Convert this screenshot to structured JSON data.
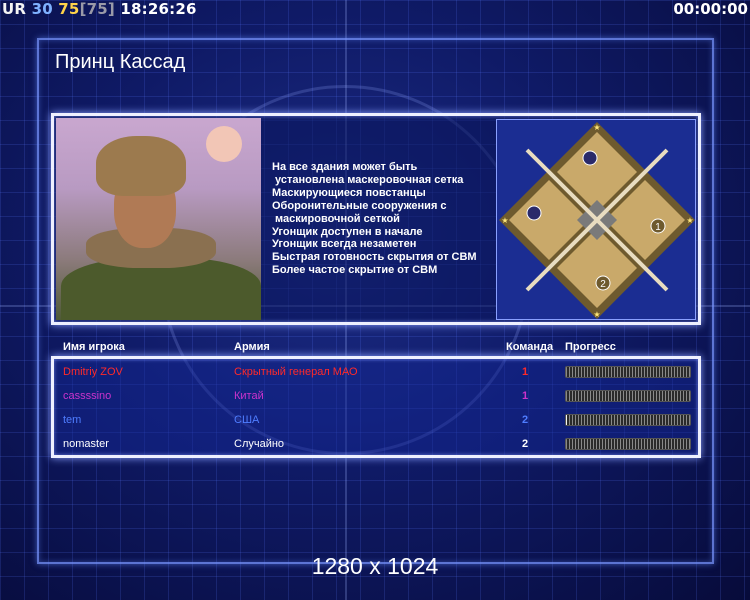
{
  "hud": {
    "ur_label": "UR",
    "ur_value": "30",
    "fps": "75",
    "fps_limit": "[75]",
    "clock": "18:26:26",
    "game_timer": "00:00:00"
  },
  "title": "Принц Кассад",
  "briefing_lines": [
    "На все здания может быть",
    " установлена маскеровочная сетка",
    "Маскирующиеся повстанцы",
    "Оборонительные сооружения с",
    " маскировочной сеткой",
    "Угонщик доступен в начале",
    "Угонщик всегда незаметен",
    "Быстрая готовность скрытия от СВМ",
    "Более частое скрытие от СВМ"
  ],
  "minimap": {
    "start_positions": [
      "1",
      "2"
    ]
  },
  "table": {
    "headers": {
      "player": "Имя игрока",
      "army": "Армия",
      "team": "Команда",
      "progress": "Прогресс"
    },
    "rows": [
      {
        "name": "Dmitriy ZOV",
        "army": "Скрытный генерал МАО",
        "team": "1",
        "progress": 0.0,
        "color": "#ff2a2a"
      },
      {
        "name": "cassssino",
        "army": "Китай",
        "team": "1",
        "progress": 0.0,
        "color": "#cc33cc"
      },
      {
        "name": "tem",
        "army": "США",
        "team": "2",
        "progress": 0.01,
        "color": "#4f7dff"
      },
      {
        "name": "nomaster",
        "army": "Случайно",
        "team": "2",
        "progress": 0.0,
        "color": "#ffffff"
      }
    ]
  },
  "resolution": "1280 x 1024"
}
